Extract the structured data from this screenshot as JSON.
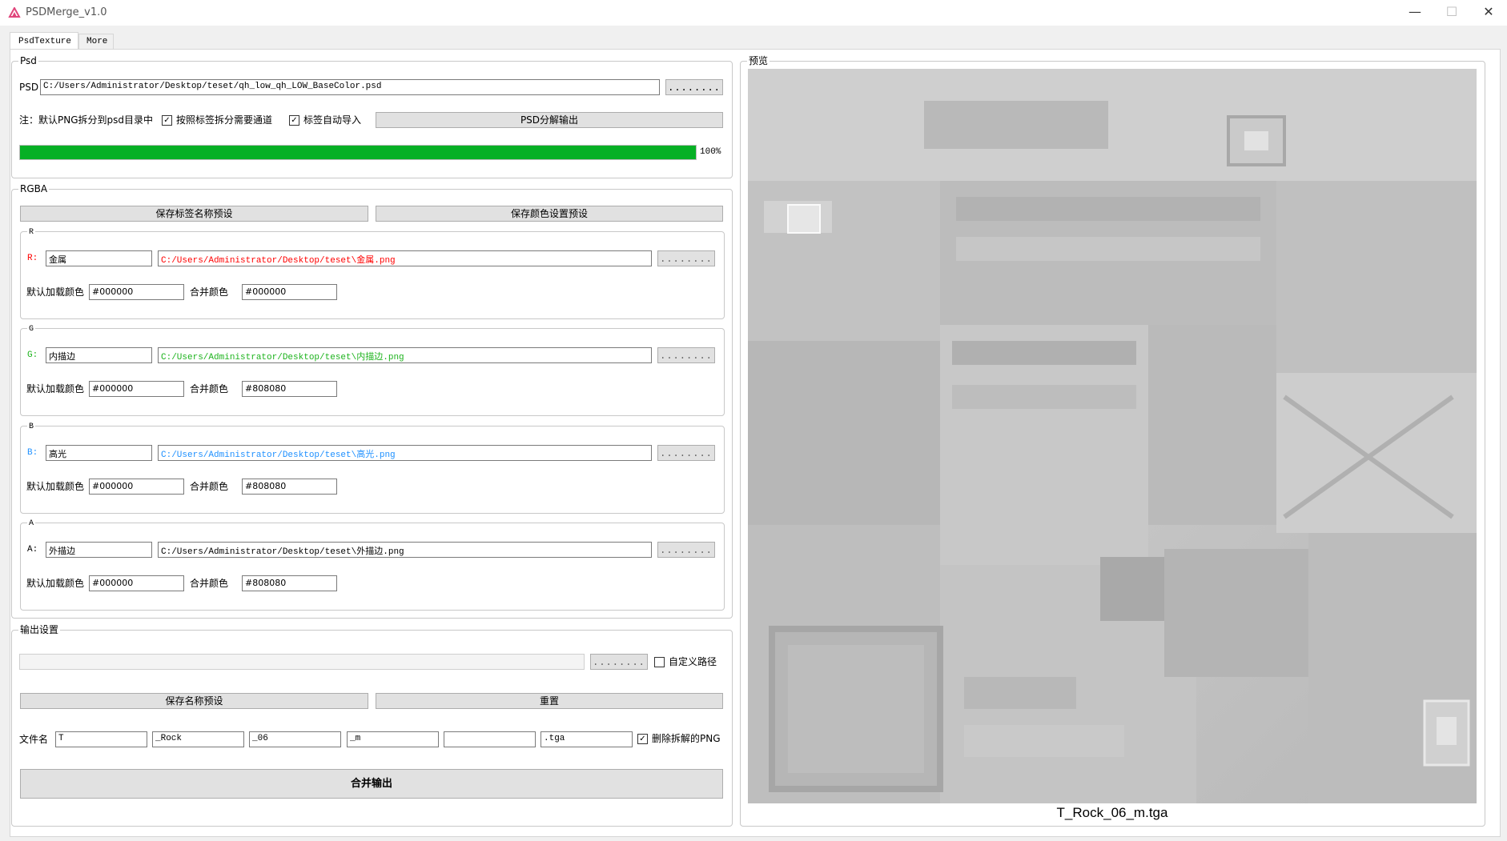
{
  "window": {
    "title": "PSDMerge_v1.0"
  },
  "tabs": [
    {
      "label": "PsdTexture",
      "active": true
    },
    {
      "label": "More",
      "active": false
    }
  ],
  "psd": {
    "group_title": "Psd",
    "label": "PSD",
    "path": "C:/Users/Administrator/Desktop/teset/qh_low_qh_LOW_BaseColor.psd",
    "browse_label": "........",
    "note": "注：默认PNG拆分到psd目录中",
    "split_by_tag": {
      "label": "按照标签拆分需要通道",
      "checked": true
    },
    "auto_import": {
      "label": "标签自动导入",
      "checked": true
    },
    "split_button": "PSD分解输出",
    "progress": {
      "value": 1.0,
      "text": "100%"
    }
  },
  "rgba": {
    "group_title": "RGBA",
    "save_tag_preset": "保存标签名称预设",
    "save_color_preset": "保存颜色设置预设",
    "channels": [
      {
        "title": "R",
        "prefix": "R:",
        "name": "金属",
        "path": "C:/Users/Administrator/Desktop/teset\\金属.png",
        "color": "#ff0000",
        "default_color_label": "默认加载颜色",
        "default_color": "#000000",
        "merge_color_label": "合并颜色",
        "merge_color": "#000000",
        "browse_label": "........"
      },
      {
        "title": "G",
        "prefix": "G:",
        "name": "内描边",
        "path": "C:/Users/Administrator/Desktop/teset\\内描边.png",
        "color": "#1db31d",
        "default_color_label": "默认加载颜色",
        "default_color": "#000000",
        "merge_color_label": "合并颜色",
        "merge_color": "#808080",
        "browse_label": "........"
      },
      {
        "title": "B",
        "prefix": "B:",
        "name": "高光",
        "path": "C:/Users/Administrator/Desktop/teset\\高光.png",
        "color": "#1e90ff",
        "default_color_label": "默认加载颜色",
        "default_color": "#000000",
        "merge_color_label": "合并颜色",
        "merge_color": "#808080",
        "browse_label": "........"
      },
      {
        "title": "A",
        "prefix": "A:",
        "name": "外描边",
        "path": "C:/Users/Administrator/Desktop/teset\\外描边.png",
        "color": "#000000",
        "default_color_label": "默认加载颜色",
        "default_color": "#000000",
        "merge_color_label": "合并颜色",
        "merge_color": "#808080",
        "browse_label": "........"
      }
    ]
  },
  "output": {
    "group_title": "输出设置",
    "path": "",
    "browse_label": "........",
    "custom_path": {
      "label": "自定义路径",
      "checked": false
    },
    "save_name_preset": "保存名称预设",
    "reset": "重置",
    "filename_label": "文件名",
    "filename_parts": [
      "T",
      "_Rock",
      "_06",
      "_m",
      "",
      ".tga"
    ],
    "delete_png": {
      "label": "删除拆解的PNG",
      "checked": true
    },
    "merge_button": "合并输出"
  },
  "preview": {
    "group_title": "预览",
    "caption": "T_Rock_06_m.tga"
  }
}
